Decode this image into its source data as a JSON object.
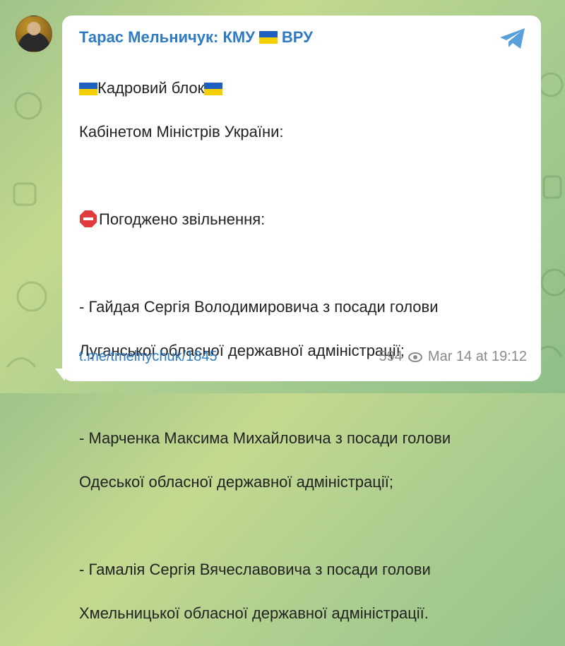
{
  "channel": {
    "name": "Тарас Мельничук: КМУ",
    "name_suffix": "ВРУ"
  },
  "message": {
    "lines": [
      "Кадровий блок",
      "Кабінетом Міністрів України:",
      "",
      "Погоджено звільнення:",
      "",
      "- Гайдая Сергія Володимировича з посади голови",
      "Луганської обласної державної адміністрації;",
      "",
      "- Марченка Максима Михайловича з посади голови",
      "Одеської обласної державної адміністрації;",
      "",
      "- Гамалія Сергія Вячеславовича з посади голови",
      "Хмельницької обласної державної адміністрації."
    ],
    "link": "t.me/tmelnychuk/1845",
    "views": "594",
    "timestamp": "Mar 14 at 19:12"
  },
  "colors": {
    "link": "#2e7bc4",
    "flag_blue": "#1f5fbf",
    "flag_yellow": "#f5d000",
    "stop_red": "#e23b3b"
  },
  "icons": {
    "share": "telegram-share-icon",
    "views": "eye-icon",
    "flag": "ukraine-flag-icon",
    "stop": "stop-sign-icon"
  }
}
